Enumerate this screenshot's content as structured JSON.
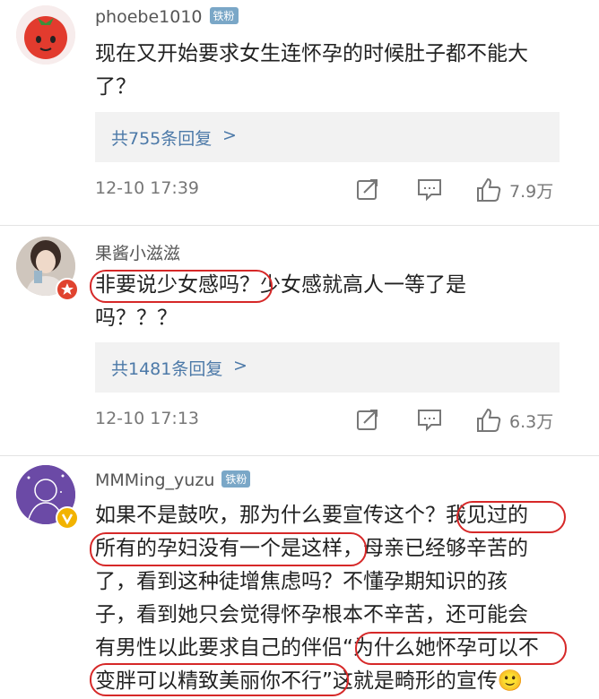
{
  "comments": [
    {
      "username": "phoebe1010",
      "badge": "铁粉",
      "lines": [
        "现在又开始要求女生连怀孕的时候肚子都不能大",
        "了？"
      ],
      "reply_label": "共755条回复",
      "reply_arrow": ">",
      "date": "12-10 17:39",
      "likes": "7.9万"
    },
    {
      "username": "果酱小滋滋",
      "badge": "",
      "lines": [
        "非要说少女感吗？少女感就高人一等了是",
        "吗？？？"
      ],
      "reply_label": "共1481条回复",
      "reply_arrow": ">",
      "date": "12-10 17:13",
      "likes": "6.3万"
    },
    {
      "username": "MMMing_yuzu",
      "badge": "铁粉",
      "lines": [
        "如果不是鼓吹，那为什么要宣传这个？我见过的",
        "所有的孕妇没有一个是这样，母亲已经够辛苦的",
        "了，看到这种徒增焦虑吗？不懂孕期知识的孩",
        "子，看到她只会觉得怀孕根本不辛苦，还可能会",
        "有男性以此要求自己的伴侣“为什么她怀孕可以不",
        "变胖可以精致美丽你不行”这就是畸形的宣传🙂"
      ]
    }
  ],
  "colors": {
    "accent_link": "#4c79a8",
    "highlight_circle": "#d62828",
    "badge_bg": "#7aa7c7",
    "reply_bg": "#f2f2f2"
  },
  "icons": [
    "avatar-tomato",
    "avatar-photo",
    "avatar-line-art",
    "repost-icon",
    "comment-icon",
    "like-icon"
  ]
}
